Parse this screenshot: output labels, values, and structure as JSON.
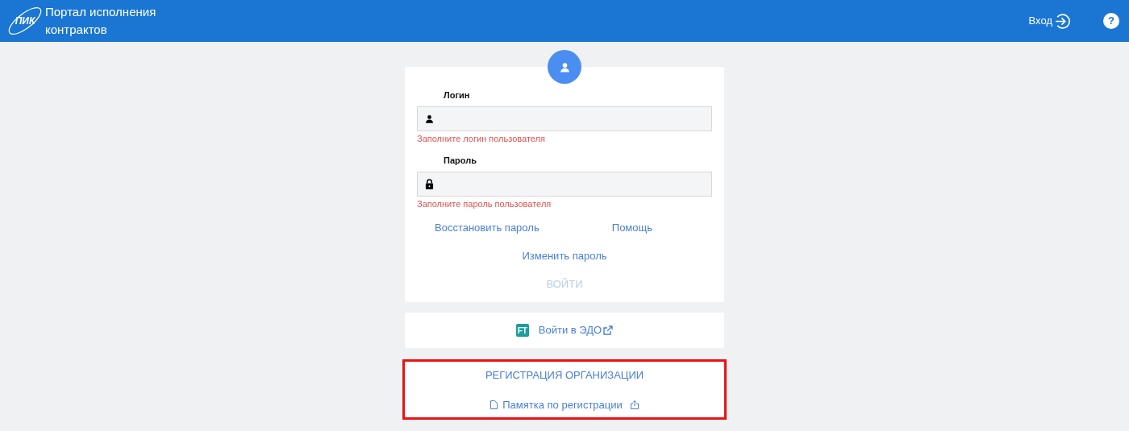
{
  "header": {
    "logo_text": "ПИК",
    "title": "Портал исполнения контрактов",
    "login_link": "Вход",
    "help_icon": "?"
  },
  "login_form": {
    "fields": [
      {
        "kind": "user",
        "label": "Логин",
        "error": "Заполните логин пользователя"
      },
      {
        "kind": "lock",
        "label": "Пароль",
        "error": "Заполните пароль пользователя"
      }
    ],
    "links": [
      "Восстановить пароль",
      "Помощь",
      "Изменить пароль"
    ],
    "submit": {
      "label": "ВОЙТИ",
      "disabled": true
    }
  },
  "edo": {
    "logo_text": "FT",
    "label": "Войти в ЭДО"
  },
  "registration": {
    "highlighted": true,
    "title": "РЕГИСТРАЦИЯ ОРГАНИЗАЦИИ",
    "memo_link": "Памятка по регистрации"
  }
}
